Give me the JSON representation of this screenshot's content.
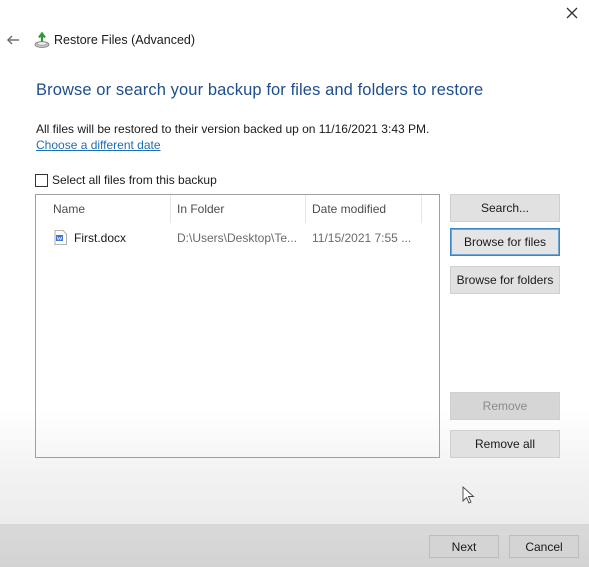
{
  "window": {
    "title": "Restore Files (Advanced)",
    "back_icon": "arrow-left-icon",
    "app_icon": "backup-restore-icon",
    "close_icon": "close-icon"
  },
  "main": {
    "heading": "Browse or search your backup for files and folders to restore",
    "info_text": "All files will be restored to their version backed up on 11/16/2021 3:43 PM.",
    "change_date_link": "Choose a different date",
    "select_all_label": "Select all files from this backup",
    "select_all_checked": false
  },
  "file_list": {
    "columns": [
      "Name",
      "In Folder",
      "Date modified"
    ],
    "rows": [
      {
        "icon": "word-document-icon",
        "name": "First.docx",
        "folder": "D:\\Users\\Desktop\\Te...",
        "date_modified": "11/15/2021 7:55 ..."
      }
    ]
  },
  "side_buttons": {
    "search": "Search...",
    "browse_files": "Browse for files",
    "browse_folders": "Browse for folders",
    "remove": "Remove",
    "remove_all": "Remove all"
  },
  "footer": {
    "next": "Next",
    "cancel": "Cancel"
  },
  "colors": {
    "heading": "#1e4e8c",
    "link": "#1f6fb4",
    "focus_border": "#3c86c4"
  }
}
